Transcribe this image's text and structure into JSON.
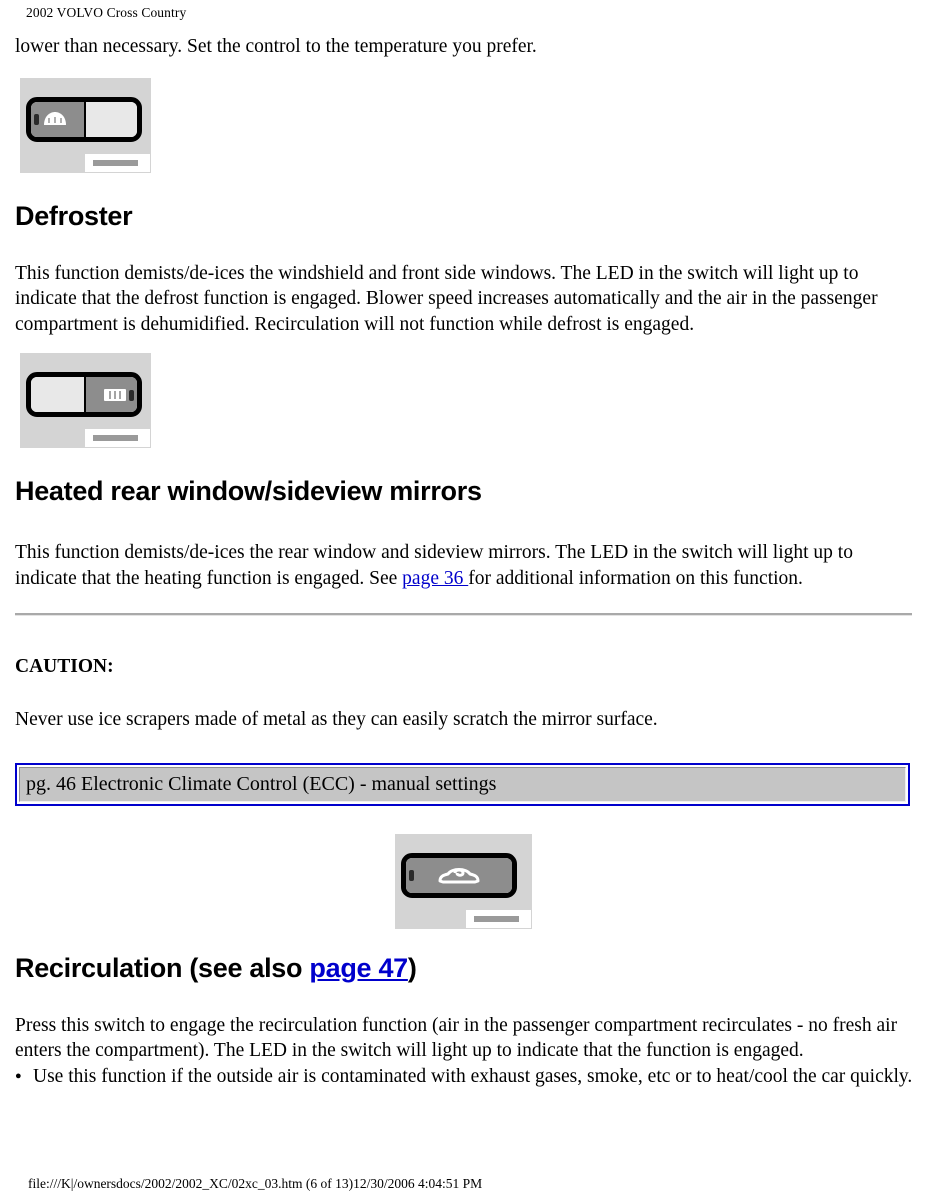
{
  "header": {
    "running_title": "2002 VOLVO Cross Country"
  },
  "content": {
    "lead_paragraph": "lower than necessary. Set the control to the temperature you prefer.",
    "defroster": {
      "heading": "Defroster",
      "paragraph": "This function demists/de-ices the windshield and front side windows. The LED in the switch will light up to indicate that the defrost function is engaged. Blower speed increases automatically and the air in the passenger compartment is dehumidified. Recirculation will not function while defrost is engaged."
    },
    "heated_rear": {
      "heading": "Heated rear window/sideview mirrors",
      "paragraph_before_link": "This function demists/de-ices the rear window and sideview mirrors. The LED in the switch will light up to indicate that the heating function is engaged. See ",
      "link_label": "page 36 ",
      "paragraph_after_link": "for additional information on this function."
    },
    "caution": {
      "label": "CAUTION:",
      "text": "Never use ice scrapers made of metal as they can easily scratch the mirror surface."
    },
    "nav_box": {
      "label": "pg. 46 Electronic Climate Control (ECC) - manual settings",
      "border_color": "#0000CC",
      "fill_color": "#C5C5C5"
    },
    "recirculation": {
      "heading_prefix": "Recirculation (see also ",
      "heading_link": "page 47",
      "heading_suffix": ")",
      "paragraph": "Press this switch to engage the recirculation function (air in the passenger compartment recirculates - no fresh air enters the compartment). The LED in the switch will light up to indicate that the function is engaged.",
      "bullets": [
        "Use this function if the outside air is contaminated with exhaust gases, smoke, etc or to heat/cool the car quickly."
      ]
    },
    "figures": [
      {
        "name": "windshield-defroster-switch",
        "alt": "Climate control switch with windshield defroster symbol illuminated on left half"
      },
      {
        "name": "rear-window-defroster-switch",
        "alt": "Climate control switch with rear window defroster symbol on right half"
      },
      {
        "name": "recirculation-switch",
        "alt": "Climate control switch with recirculation (car with circulating arrow) symbol"
      }
    ]
  },
  "footer": {
    "path_line": "file:///K|/ownersdocs/2002/2002_XC/02xc_03.htm (6 of 13)12/30/2006 4:04:51 PM"
  },
  "colors": {
    "link": "#0000CC",
    "page_background": "#FFFFFF",
    "figure_background": "#D4D4D4",
    "rule": "#A9A9A9"
  }
}
